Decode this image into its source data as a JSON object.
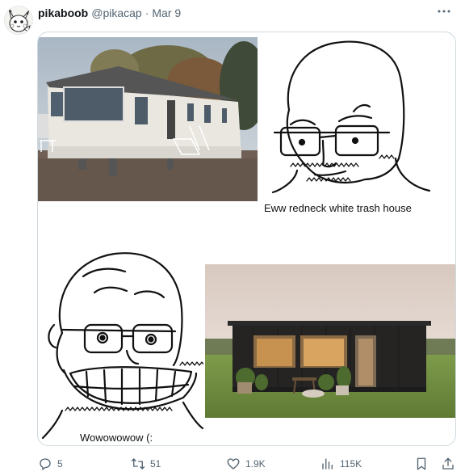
{
  "user": {
    "name": "pikaboob",
    "handle": "@pikacap",
    "separator": "·",
    "date": "Mar 9"
  },
  "media": {
    "caption_top": "Eww redneck white trash house",
    "caption_bottom": "Wowowowow (:"
  },
  "actions": {
    "replies": "5",
    "reposts": "51",
    "likes": "1.9K",
    "views": "115K"
  },
  "colors": {
    "text_secondary": "#536471",
    "border": "#cfd9de"
  },
  "icons": [
    "more-icon",
    "reply-icon",
    "repost-icon",
    "like-icon",
    "views-icon",
    "bookmark-icon",
    "share-icon"
  ]
}
